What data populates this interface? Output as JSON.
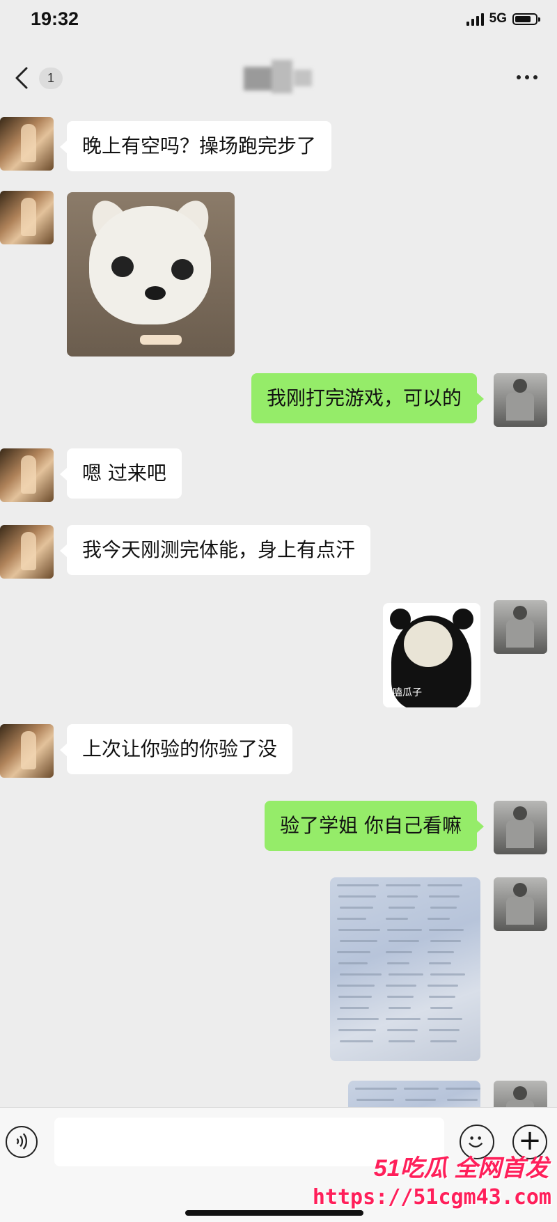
{
  "status_bar": {
    "time": "19:32",
    "network": "5G",
    "battery_level": 0.8
  },
  "nav": {
    "unread_count": "1"
  },
  "messages": [
    {
      "side": "them",
      "type": "text",
      "text": "晚上有空吗？操场跑完步了"
    },
    {
      "side": "them",
      "type": "image",
      "image": "dog-meme-sticker"
    },
    {
      "side": "me",
      "type": "text",
      "text": "我刚打完游戏，可以的"
    },
    {
      "side": "them",
      "type": "text",
      "text": "嗯 过来吧"
    },
    {
      "side": "them",
      "type": "text",
      "text": "我今天刚测完体能，身上有点汗"
    },
    {
      "side": "me",
      "type": "image",
      "image": "panda-meme-sticker",
      "caption": "嗑瓜子"
    },
    {
      "side": "them",
      "type": "text",
      "text": "上次让你验的你验了没"
    },
    {
      "side": "me",
      "type": "text",
      "text": "验了学姐 你自己看嘛"
    },
    {
      "side": "me",
      "type": "image",
      "image": "medical-report-photo"
    },
    {
      "side": "me",
      "type": "image",
      "image": "medical-report-photo-2"
    }
  ],
  "input_bar": {
    "icons": [
      "voice-icon",
      "emoji-icon",
      "plus-icon"
    ]
  },
  "watermark": {
    "brand": "51吃瓜 全网首发",
    "url": "https://51cgm43.com"
  },
  "colors": {
    "my_bubble": "#95ec69",
    "their_bubble": "#ffffff",
    "background": "#ededed",
    "watermark": "#ff1f5a"
  }
}
